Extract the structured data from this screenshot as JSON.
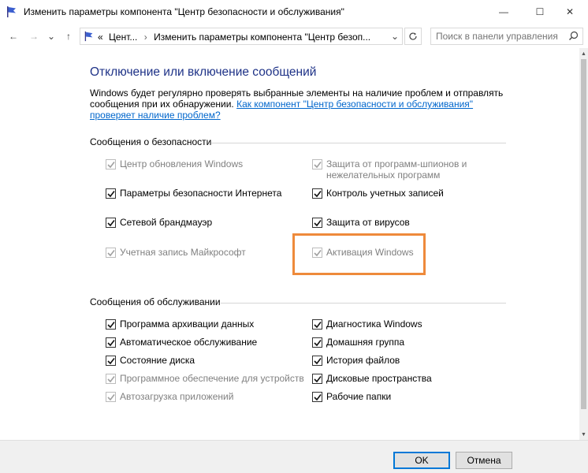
{
  "window": {
    "title": "Изменить параметры компонента \"Центр безопасности и обслуживания\"",
    "min_glyph": "—",
    "max_glyph": "☐",
    "close_glyph": "✕"
  },
  "navigation": {
    "back_glyph": "←",
    "forward_glyph": "→",
    "recent_glyph": "⌄",
    "up_glyph": "↑",
    "crumb_prefix": "«",
    "breadcrumbs": [
      "Цент...",
      "Изменить параметры компонента \"Центр безоп..."
    ],
    "crumb_separator": "›",
    "dropdown_glyph": "⌄",
    "search_placeholder": "Поиск в панели управления"
  },
  "main": {
    "heading": "Отключение или включение сообщений",
    "description": "Windows будет регулярно проверять выбранные элементы на наличие проблем и отправлять сообщения при их обнаружении. ",
    "description_link": "Как компонент \"Центр безопасности и обслуживания\" проверяет наличие проблем?",
    "security": {
      "title": "Сообщения о безопасности",
      "items": [
        {
          "label": "Центр обновления Windows",
          "checked": true,
          "disabled": true
        },
        {
          "label": "Защита от программ-шпионов и\nнежелательных программ",
          "checked": true,
          "disabled": true
        },
        {
          "label": "Параметры безопасности Интернета",
          "checked": true,
          "disabled": false
        },
        {
          "label": "Контроль учетных записей",
          "checked": true,
          "disabled": false
        },
        {
          "label": "Сетевой брандмауэр",
          "checked": true,
          "disabled": false
        },
        {
          "label": "Защита от вирусов",
          "checked": true,
          "disabled": false
        },
        {
          "label": "Учетная запись Майкрософт",
          "checked": true,
          "disabled": true
        },
        {
          "label": "Активация Windows",
          "checked": true,
          "disabled": true
        }
      ]
    },
    "maintenance": {
      "title": "Сообщения об обслуживании",
      "items": [
        {
          "label": "Программа архивации данных",
          "checked": true,
          "disabled": false
        },
        {
          "label": "Диагностика Windows",
          "checked": true,
          "disabled": false
        },
        {
          "label": "Автоматическое обслуживание",
          "checked": true,
          "disabled": false
        },
        {
          "label": "Домашняя группа",
          "checked": true,
          "disabled": false
        },
        {
          "label": "Состояние диска",
          "checked": true,
          "disabled": false
        },
        {
          "label": "История файлов",
          "checked": true,
          "disabled": false
        },
        {
          "label": "Программное обеспечение для устройств",
          "checked": true,
          "disabled": true
        },
        {
          "label": "Дисковые пространства",
          "checked": true,
          "disabled": false
        },
        {
          "label": "Автозагрузка приложений",
          "checked": true,
          "disabled": true
        },
        {
          "label": "Рабочие папки",
          "checked": true,
          "disabled": false
        }
      ]
    }
  },
  "buttons": {
    "ok": "OK",
    "cancel": "Отмена"
  },
  "colors": {
    "heading": "#1e3287",
    "link": "#0066cc",
    "highlight": "#ee8a3b"
  }
}
